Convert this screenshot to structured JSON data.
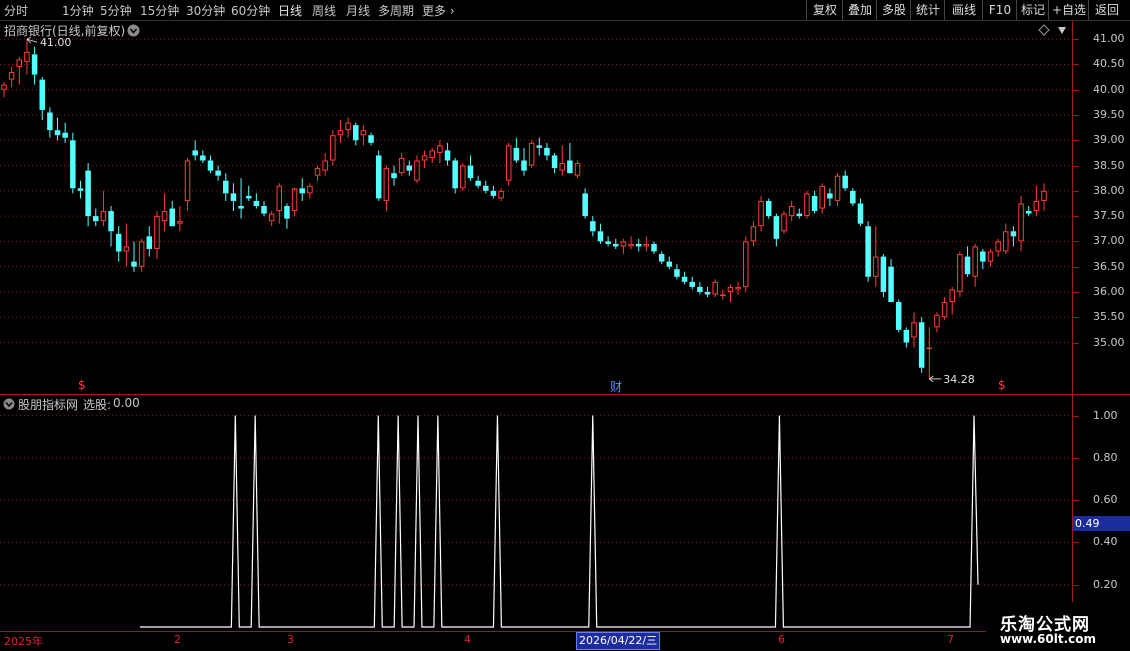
{
  "toolbar": {
    "periods": [
      "分时",
      "1分钟",
      "5分钟",
      "15分钟",
      "30分钟",
      "60分钟",
      "日线",
      "周线",
      "月线",
      "多周期",
      "更多"
    ],
    "active_period": "日线",
    "more_arrow": "›",
    "buttons": [
      "复权",
      "叠加",
      "多股",
      "统计",
      "画线",
      "F10",
      "标记",
      "+自选",
      "返回"
    ]
  },
  "main_chart": {
    "title": "招商银行(日线,前复权)",
    "dropdown_icon": "chevron-down-icon",
    "high_label": "41.00",
    "low_label": "34.28",
    "markers": [
      "$",
      "财",
      "$"
    ],
    "price_ticks": [
      "41.00",
      "40.50",
      "40.00",
      "39.50",
      "39.00",
      "38.50",
      "38.00",
      "37.50",
      "37.00",
      "36.50",
      "36.00",
      "35.50",
      "35.00"
    ]
  },
  "indicator": {
    "name": "股朋指标网",
    "label": "选股:",
    "value": "0.00",
    "ticks": [
      "1.00",
      "0.80",
      "0.60",
      "0.40",
      "0.20"
    ],
    "current_value": "0.49"
  },
  "date_axis": {
    "labels": [
      "2025年",
      "2",
      "3",
      "4",
      "6",
      "7"
    ],
    "cursor_date": "2026/04/22/三"
  },
  "watermark": {
    "line1": "乐淘公式网",
    "line2": "www.60lt.com"
  },
  "colors": {
    "up": "#ff3c3c",
    "down": "#54ffff",
    "grid": "#8a1a1a",
    "axis_line": "#a01818",
    "signal_line": "#ffffff",
    "highlight_bg": "#1c2c9c"
  },
  "chart_data": [
    {
      "type": "candlestick",
      "title": "招商银行(日线,前复权)",
      "ylim": [
        34.1,
        41.3
      ],
      "y_ticks": [
        41.0,
        40.5,
        40.0,
        39.5,
        39.0,
        38.5,
        38.0,
        37.5,
        37.0,
        36.5,
        36.0,
        35.5,
        35.0
      ],
      "fields": [
        "open",
        "high",
        "low",
        "close"
      ],
      "candles": [
        [
          40.0,
          40.15,
          39.85,
          40.1
        ],
        [
          40.2,
          40.45,
          40.05,
          40.35
        ],
        [
          40.45,
          40.65,
          40.1,
          40.6
        ],
        [
          40.55,
          41.0,
          40.3,
          40.75
        ],
        [
          40.7,
          40.85,
          40.1,
          40.3
        ],
        [
          40.2,
          40.25,
          39.4,
          39.6
        ],
        [
          39.55,
          39.65,
          39.05,
          39.2
        ],
        [
          39.2,
          39.45,
          39.0,
          39.1
        ],
        [
          39.15,
          39.35,
          38.95,
          39.05
        ],
        [
          39.0,
          39.15,
          37.95,
          38.05
        ],
        [
          38.05,
          38.2,
          37.85,
          38.0
        ],
        [
          38.4,
          38.55,
          37.3,
          37.5
        ],
        [
          37.5,
          37.65,
          37.3,
          37.4
        ],
        [
          37.4,
          38.0,
          37.3,
          37.6
        ],
        [
          37.6,
          37.7,
          36.9,
          37.2
        ],
        [
          37.15,
          37.3,
          36.6,
          36.8
        ],
        [
          36.8,
          37.35,
          36.5,
          36.9
        ],
        [
          36.6,
          37.0,
          36.4,
          36.5
        ],
        [
          36.5,
          37.05,
          36.4,
          37.0
        ],
        [
          37.1,
          37.3,
          36.7,
          36.85
        ],
        [
          36.85,
          37.6,
          36.65,
          37.5
        ],
        [
          37.4,
          37.95,
          37.2,
          37.6
        ],
        [
          37.65,
          37.8,
          37.3,
          37.3
        ],
        [
          37.35,
          37.7,
          37.2,
          37.4
        ],
        [
          37.8,
          38.65,
          37.6,
          38.6
        ],
        [
          38.8,
          39.0,
          38.6,
          38.7
        ],
        [
          38.7,
          38.8,
          38.55,
          38.6
        ],
        [
          38.6,
          38.7,
          38.35,
          38.4
        ],
        [
          38.4,
          38.5,
          38.2,
          38.3
        ],
        [
          38.2,
          38.35,
          37.8,
          37.95
        ],
        [
          37.95,
          38.15,
          37.6,
          37.8
        ],
        [
          37.7,
          38.25,
          37.45,
          37.65
        ],
        [
          37.9,
          38.1,
          37.8,
          37.85
        ],
        [
          37.8,
          37.95,
          37.65,
          37.7
        ],
        [
          37.7,
          37.8,
          37.5,
          37.55
        ],
        [
          37.4,
          37.6,
          37.3,
          37.55
        ],
        [
          37.6,
          38.15,
          37.35,
          38.1
        ],
        [
          37.7,
          37.75,
          37.25,
          37.45
        ],
        [
          37.6,
          38.0,
          37.5,
          38.05
        ],
        [
          38.05,
          38.25,
          37.8,
          37.95
        ],
        [
          37.95,
          38.15,
          37.85,
          38.1
        ],
        [
          38.3,
          38.5,
          38.2,
          38.45
        ],
        [
          38.4,
          38.75,
          38.3,
          38.6
        ],
        [
          38.6,
          39.2,
          38.5,
          39.1
        ],
        [
          39.1,
          39.4,
          38.95,
          39.2
        ],
        [
          39.2,
          39.45,
          39.05,
          39.35
        ],
        [
          39.3,
          39.35,
          38.9,
          39.0
        ],
        [
          39.1,
          39.3,
          38.9,
          39.2
        ],
        [
          39.1,
          39.15,
          38.9,
          38.95
        ],
        [
          38.7,
          38.8,
          37.8,
          37.85
        ],
        [
          37.8,
          38.5,
          37.6,
          38.45
        ],
        [
          38.35,
          38.5,
          38.1,
          38.25
        ],
        [
          38.35,
          38.75,
          38.3,
          38.65
        ],
        [
          38.5,
          38.6,
          38.3,
          38.4
        ],
        [
          38.2,
          38.7,
          38.15,
          38.6
        ],
        [
          38.6,
          38.8,
          38.45,
          38.7
        ],
        [
          38.65,
          38.85,
          38.55,
          38.8
        ],
        [
          38.75,
          39.0,
          38.55,
          38.9
        ],
        [
          38.8,
          38.95,
          38.5,
          38.6
        ],
        [
          38.6,
          38.65,
          37.95,
          38.05
        ],
        [
          38.05,
          38.55,
          38.0,
          38.5
        ],
        [
          38.5,
          38.7,
          38.2,
          38.25
        ],
        [
          38.2,
          38.3,
          38.05,
          38.1
        ],
        [
          38.1,
          38.2,
          37.95,
          38.0
        ],
        [
          38.0,
          38.1,
          37.85,
          37.9
        ],
        [
          37.85,
          38.05,
          37.8,
          38.0
        ],
        [
          38.2,
          38.95,
          38.1,
          38.9
        ],
        [
          38.85,
          39.05,
          38.55,
          38.6
        ],
        [
          38.6,
          38.85,
          38.3,
          38.4
        ],
        [
          38.5,
          39.0,
          38.45,
          38.95
        ],
        [
          38.9,
          39.05,
          38.7,
          38.85
        ],
        [
          38.85,
          38.95,
          38.6,
          38.7
        ],
        [
          38.7,
          38.75,
          38.35,
          38.45
        ],
        [
          38.4,
          38.9,
          38.3,
          38.55
        ],
        [
          38.6,
          38.95,
          38.4,
          38.35
        ],
        [
          38.3,
          38.6,
          38.25,
          38.55
        ],
        [
          37.95,
          38.05,
          37.45,
          37.5
        ],
        [
          37.4,
          37.5,
          37.1,
          37.2
        ],
        [
          37.2,
          37.35,
          36.95,
          37.0
        ],
        [
          37.0,
          37.1,
          36.9,
          36.95
        ],
        [
          36.95,
          37.05,
          36.85,
          36.9
        ],
        [
          36.9,
          37.05,
          36.75,
          37.0
        ],
        [
          36.9,
          37.1,
          36.85,
          36.95
        ],
        [
          36.95,
          37.05,
          36.8,
          36.9
        ],
        [
          36.9,
          37.1,
          36.8,
          36.95
        ],
        [
          36.95,
          37.0,
          36.75,
          36.8
        ],
        [
          36.75,
          36.8,
          36.55,
          36.6
        ],
        [
          36.6,
          36.7,
          36.45,
          36.5
        ],
        [
          36.45,
          36.55,
          36.25,
          36.3
        ],
        [
          36.3,
          36.4,
          36.15,
          36.2
        ],
        [
          36.2,
          36.3,
          36.05,
          36.1
        ],
        [
          36.1,
          36.2,
          35.95,
          36.0
        ],
        [
          36.0,
          36.1,
          35.9,
          35.95
        ],
        [
          35.95,
          36.25,
          35.9,
          36.2
        ],
        [
          35.95,
          36.05,
          35.85,
          35.95
        ],
        [
          36.0,
          36.15,
          35.8,
          36.1
        ],
        [
          36.05,
          36.2,
          35.95,
          36.1
        ],
        [
          36.1,
          37.1,
          36.0,
          37.0
        ],
        [
          37.0,
          37.4,
          36.9,
          37.3
        ],
        [
          37.3,
          37.9,
          37.2,
          37.8
        ],
        [
          37.8,
          37.85,
          37.45,
          37.5
        ],
        [
          37.5,
          37.55,
          36.9,
          37.05
        ],
        [
          37.2,
          37.6,
          37.15,
          37.55
        ],
        [
          37.5,
          37.8,
          37.4,
          37.7
        ],
        [
          37.55,
          37.65,
          37.45,
          37.5
        ],
        [
          37.5,
          38.0,
          37.45,
          37.95
        ],
        [
          37.9,
          38.0,
          37.55,
          37.6
        ],
        [
          37.65,
          38.15,
          37.55,
          38.1
        ],
        [
          37.95,
          38.05,
          37.7,
          37.85
        ],
        [
          37.8,
          38.35,
          37.7,
          38.3
        ],
        [
          38.3,
          38.4,
          38.0,
          38.05
        ],
        [
          38.0,
          38.05,
          37.7,
          37.75
        ],
        [
          37.75,
          37.85,
          37.3,
          37.35
        ],
        [
          37.3,
          37.4,
          36.2,
          36.3
        ],
        [
          36.3,
          37.3,
          36.1,
          36.7
        ],
        [
          36.7,
          36.75,
          35.9,
          36.0
        ],
        [
          36.5,
          36.65,
          35.8,
          35.8
        ],
        [
          35.8,
          35.85,
          35.2,
          35.25
        ],
        [
          35.25,
          35.3,
          34.9,
          35.0
        ],
        [
          35.1,
          35.6,
          34.9,
          35.4
        ],
        [
          35.4,
          35.5,
          34.4,
          34.5
        ],
        [
          34.9,
          35.3,
          34.28,
          34.9
        ],
        [
          35.3,
          35.6,
          35.2,
          35.55
        ],
        [
          35.5,
          35.9,
          35.45,
          35.8
        ],
        [
          35.8,
          36.1,
          35.55,
          36.05
        ],
        [
          36.0,
          36.8,
          35.9,
          36.75
        ],
        [
          36.7,
          36.9,
          36.3,
          36.35
        ],
        [
          36.3,
          36.95,
          36.1,
          36.9
        ],
        [
          36.8,
          36.85,
          36.45,
          36.6
        ],
        [
          36.6,
          36.85,
          36.5,
          36.8
        ],
        [
          36.8,
          37.05,
          36.7,
          37.0
        ],
        [
          36.8,
          37.35,
          36.75,
          37.2
        ],
        [
          37.2,
          37.3,
          36.9,
          37.1
        ],
        [
          37.0,
          37.9,
          36.8,
          37.75
        ],
        [
          37.6,
          37.7,
          37.5,
          37.55
        ],
        [
          37.6,
          38.1,
          37.5,
          37.8
        ],
        [
          37.8,
          38.15,
          37.6,
          38.0
        ]
      ]
    },
    {
      "type": "line",
      "title": "股朋指标网",
      "ylim": [
        0,
        1.05
      ],
      "y_ticks": [
        1.0,
        0.8,
        0.6,
        0.4,
        0.2
      ],
      "baseline": 0,
      "series": [
        {
          "values": [
            0,
            0,
            0,
            0,
            0,
            0,
            0,
            0,
            0,
            0,
            0,
            0,
            0,
            0,
            0,
            0,
            0,
            0,
            0,
            0,
            0,
            0,
            0,
            0,
            1,
            0,
            0,
            0,
            0,
            1,
            0,
            0,
            0,
            0,
            0,
            0,
            0,
            0,
            0,
            0,
            0,
            0,
            0,
            0,
            0,
            0,
            0,
            0,
            0,
            0,
            0,
            0,
            0,
            0,
            0,
            0,
            0,
            0,
            0,
            0,
            1,
            0,
            0,
            0,
            0,
            1,
            0,
            0,
            0,
            0,
            1,
            0,
            0,
            0,
            0,
            1,
            0,
            0,
            0,
            0,
            0,
            0,
            0,
            0,
            0,
            0,
            0,
            0,
            0,
            0,
            1,
            0,
            0,
            0,
            0,
            0,
            0,
            0,
            0,
            0,
            0,
            0,
            0,
            0,
            0,
            0,
            0,
            0,
            0,
            0,
            0,
            0,
            0,
            0,
            1,
            0,
            0,
            0,
            0,
            0,
            0,
            0,
            0,
            0,
            0,
            0,
            0,
            0,
            0,
            0,
            0,
            0,
            0,
            0,
            0,
            0,
            0,
            0,
            0,
            0,
            0,
            0,
            0,
            0,
            0,
            0,
            0,
            0,
            0,
            0,
            0,
            0,
            0,
            0,
            0,
            0,
            0,
            0,
            0,
            0,
            0,
            1,
            0,
            0,
            0,
            0,
            0,
            0,
            0,
            0,
            0,
            0,
            0,
            0,
            0,
            0,
            0,
            0,
            0,
            0,
            0,
            0,
            0,
            0,
            0,
            0,
            0,
            0,
            0,
            0,
            0,
            0,
            0,
            0,
            0,
            0,
            0,
            0,
            0,
            0,
            0,
            0,
            0,
            0,
            0,
            0,
            0,
            0,
            0,
            0,
            1,
            0.2
          ]
        }
      ]
    }
  ]
}
